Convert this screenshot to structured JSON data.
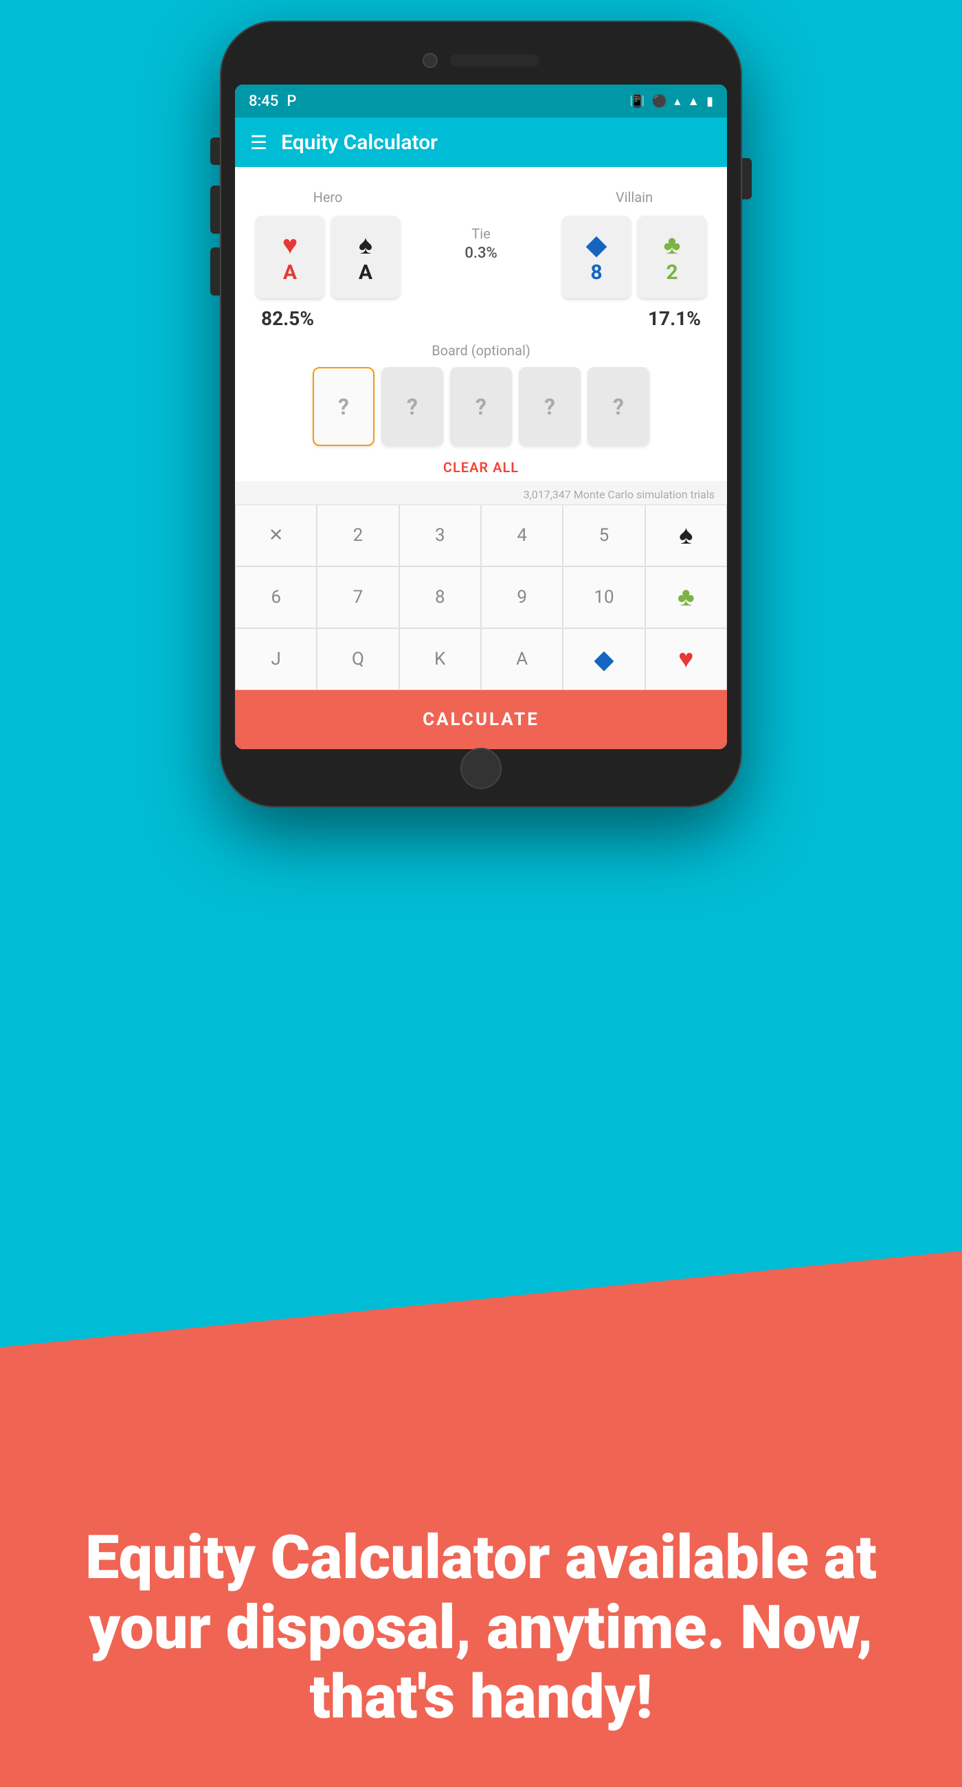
{
  "background": {
    "main_color": "#00BCD4",
    "coral_color": "#F06454"
  },
  "status_bar": {
    "time": "8:45",
    "app_indicator": "P"
  },
  "app_bar": {
    "title": "Equity Calculator"
  },
  "hero": {
    "label": "Hero",
    "card1": {
      "suit": "heart",
      "rank": "A"
    },
    "card2": {
      "suit": "spade",
      "rank": "A"
    },
    "equity": "82.5%"
  },
  "tie": {
    "label": "Tie",
    "value": "0.3%"
  },
  "villain": {
    "label": "Villain",
    "card1": {
      "suit": "diamond",
      "rank": "8"
    },
    "card2": {
      "suit": "club-green",
      "rank": "2"
    },
    "equity": "17.1%"
  },
  "board": {
    "label": "Board (optional)",
    "cards": [
      "?",
      "?",
      "?",
      "?",
      "?"
    ]
  },
  "clear_all": "CLEAR ALL",
  "simulation": {
    "info": "3,017,347 Monte Carlo simulation trials"
  },
  "keypad": {
    "row1": [
      "X",
      "2",
      "3",
      "4",
      "5",
      "♠",
      "♣"
    ],
    "row2": [
      "6",
      "7",
      "8",
      "9",
      "10",
      "♦",
      "♥"
    ],
    "row3": [
      "J",
      "Q",
      "K",
      "A"
    ]
  },
  "calculate_button": "CALCULATE",
  "bottom_text": "Equity Calculator available at your disposal, anytime. Now, that's handy!"
}
